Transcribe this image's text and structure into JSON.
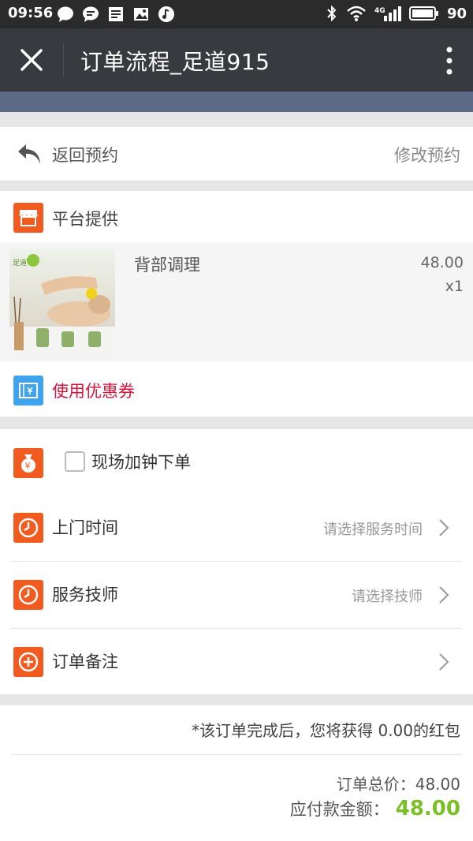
{
  "status_bar": {
    "time": "09:56",
    "network": "4G",
    "battery": "90"
  },
  "header": {
    "title": "订单流程_足道915"
  },
  "back_row": {
    "back_label": "返回预约",
    "modify_label": "修改预约"
  },
  "provider": {
    "label": "平台提供"
  },
  "product": {
    "name": "背部调理",
    "price": "48.00",
    "quantity": "x1",
    "logo_text": "足道"
  },
  "coupon": {
    "label": "使用优惠券"
  },
  "options": {
    "add_clock_label": "现场加钟下单",
    "add_clock_checked": false,
    "visit_time": {
      "label": "上门时间",
      "hint": "请选择服务时间"
    },
    "technician": {
      "label": "服务技师",
      "hint": "请选择技师"
    },
    "note": {
      "label": "订单备注"
    }
  },
  "summary": {
    "notice": "*该订单完成后，您将获得 0.00的红包",
    "total_label": "订单总价：",
    "total_value": "48.00",
    "payable_label": "应付款金额：",
    "payable_value": "48.00"
  },
  "colors": {
    "status_bg": "#2b2b2b",
    "titlebar_bg": "#393a3f",
    "banner_bg": "#5d6b87",
    "orange_icon": "#f25b1f",
    "blue_icon": "#3fa3ee",
    "coupon_text": "#d6153c",
    "payable_amount": "#7bbf26"
  }
}
